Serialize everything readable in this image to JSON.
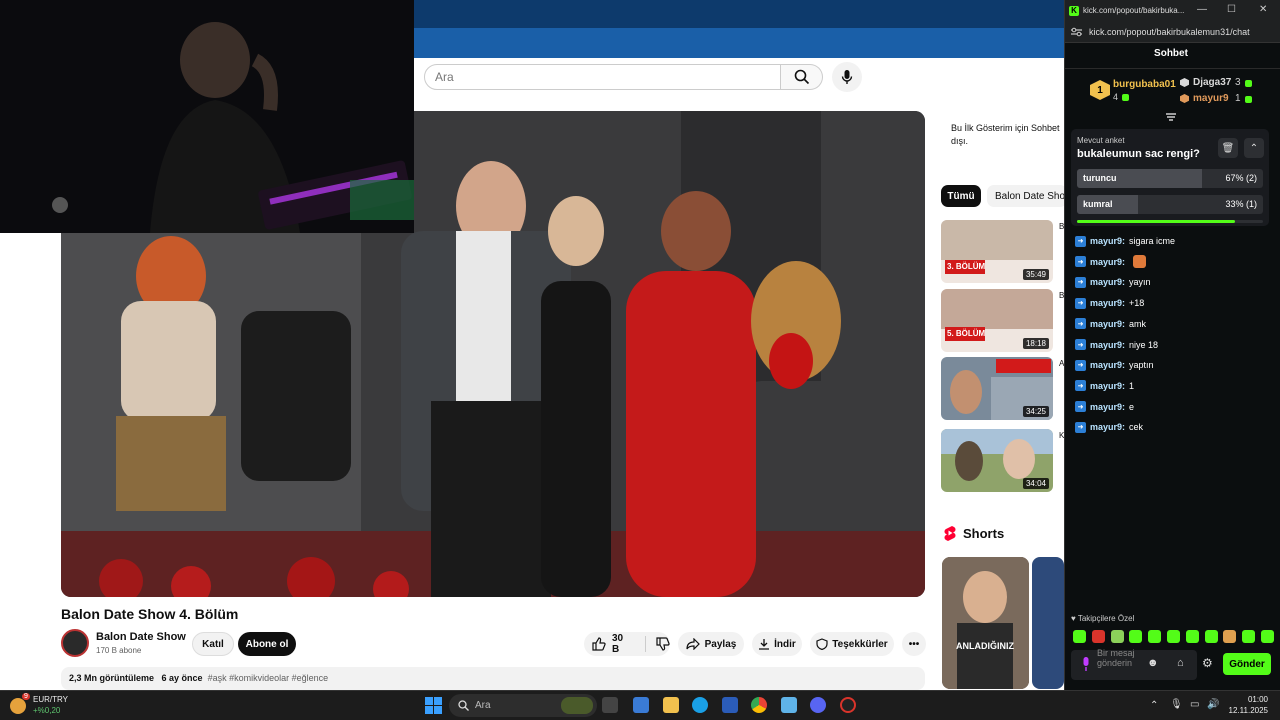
{
  "youtube": {
    "search_placeholder": "Ara",
    "video": {
      "title": "Balon Date Show 4. Bölüm",
      "channel_name": "Balon Date Show",
      "channel_subs": "170 B abone",
      "join_label": "Katıl",
      "subscribe_label": "Abone ol",
      "like_count": "30 B",
      "share_label": "Paylaş",
      "download_label": "İndir",
      "thanks_label": "Teşekkürler",
      "views": "2,3 Mn görüntüleme",
      "age": "6 ay önce",
      "tags": "#aşk #komikvideolar #eğlence"
    },
    "sidebar": {
      "note": "Bu İlk Gösterim için Sohbet dışı.",
      "chips": [
        "Tümü",
        "Balon Date Show"
      ],
      "recommendations": [
        {
          "duration": "35:49",
          "badge": "3. BÖLÜM",
          "title_initial": "B"
        },
        {
          "duration": "18:18",
          "badge": "5. BÖLÜM",
          "title_initial": "B"
        },
        {
          "duration": "34:25",
          "badge": "",
          "title_initial": "A"
        },
        {
          "duration": "34:04",
          "badge": "",
          "title_initial": "K"
        }
      ],
      "shorts_label": "Shorts",
      "short_caption": "ANLADIĞINIZ"
    }
  },
  "kick": {
    "window_title": "kick.com/popout/bakirbuka...",
    "url": "kick.com/popout/bakirbukalemun31/chat",
    "chat_title": "Sohbet",
    "top_gifters": [
      {
        "rank": "1",
        "name": "burgubaba01",
        "count": "4",
        "color": "#f2c14e"
      },
      {
        "rank": "2",
        "name": "Djaga37",
        "count": "3",
        "color": "#d9d9d9"
      },
      {
        "rank": "3",
        "name": "mayur9",
        "count": "1",
        "color": "#e19a5b"
      }
    ],
    "poll": {
      "label": "Mevcut anket",
      "question": "bukaleumun sac rengi?",
      "options": [
        {
          "name": "turuncu",
          "pct_label": "67% (2)",
          "fraction": 0.67
        },
        {
          "name": "kumral",
          "pct_label": "33% (1)",
          "fraction": 0.33
        }
      ],
      "time_remaining_fraction": 0.85
    },
    "messages": [
      {
        "user": "mayur9:",
        "text": "sigara icme"
      },
      {
        "user": "mayur9:",
        "text": ""
      },
      {
        "user": "mayur9:",
        "text": "yayın"
      },
      {
        "user": "mayur9:",
        "text": "+18"
      },
      {
        "user": "mayur9:",
        "text": "amk"
      },
      {
        "user": "mayur9:",
        "text": "niye 18"
      },
      {
        "user": "mayur9:",
        "text": "yaptın"
      },
      {
        "user": "mayur9:",
        "text": "1"
      },
      {
        "user": "mayur9:",
        "text": "e"
      },
      {
        "user": "mayur9:",
        "text": "cek"
      }
    ],
    "followers_label": "Takipçilere Özel",
    "input_placeholder": "Bir mesaj gönderin",
    "send_label": "Gönder"
  },
  "taskbar": {
    "currency_pair": "EUR/TRY",
    "currency_change": "+%0,20",
    "search_placeholder": "Ara",
    "time": "01:00",
    "date": "12.11.2025",
    "notification_count": "9"
  },
  "colors": {
    "kick_green": "#53fc18",
    "youtube_red": "#ff0033"
  }
}
